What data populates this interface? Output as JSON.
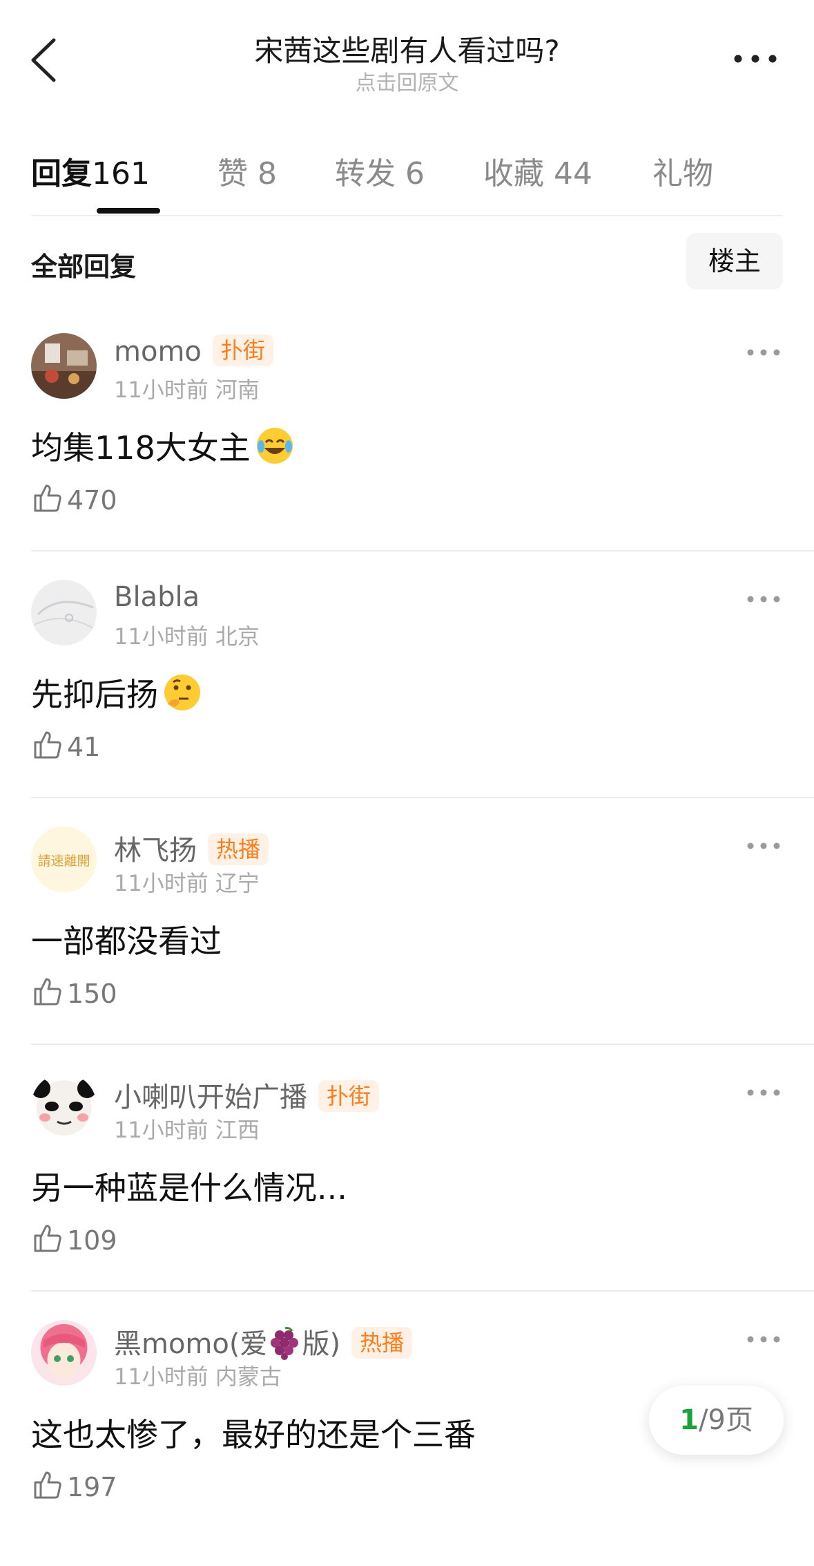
{
  "header": {
    "title": "宋茜这些剧有人看过吗?",
    "subtitle": "点击回原文"
  },
  "tabs": [
    {
      "label": "回复",
      "count": "161"
    },
    {
      "label": "赞",
      "count": "8"
    },
    {
      "label": "转发",
      "count": "6"
    },
    {
      "label": "收藏",
      "count": "44"
    },
    {
      "label": "礼物",
      "count": ""
    }
  ],
  "section": {
    "title": "全部回复",
    "filter_button": "楼主"
  },
  "comments": [
    {
      "name": "momo",
      "badge": "扑街",
      "time": "11小时前",
      "location": "河南",
      "content": "均集118大女主",
      "likes": "470"
    },
    {
      "name": "Blabla",
      "badge": "",
      "time": "11小时前",
      "location": "北京",
      "content": "先抑后扬",
      "likes": "41"
    },
    {
      "name": "林飞扬",
      "badge": "热播",
      "time": "11小时前",
      "location": "辽宁",
      "content": "一部都没看过",
      "likes": "150"
    },
    {
      "name": "小喇叭开始广播",
      "badge": "扑街",
      "time": "11小时前",
      "location": "江西",
      "content": "另一种蓝是什么情况...",
      "likes": "109"
    },
    {
      "name": "黑momo(爱",
      "name_suffix": "版)",
      "badge": "热播",
      "time": "11小时前",
      "location": "内蒙古",
      "content": "这也太惨了，最好的还是个三番",
      "likes": "197"
    }
  ],
  "avatar_text": {
    "c3": "請速離開"
  },
  "pager": {
    "current": "1",
    "total": "/9页"
  },
  "colors": {
    "badge_text": "#ff7d19",
    "badge_bg": "#fff1e6",
    "pager_current": "#1aa339"
  }
}
